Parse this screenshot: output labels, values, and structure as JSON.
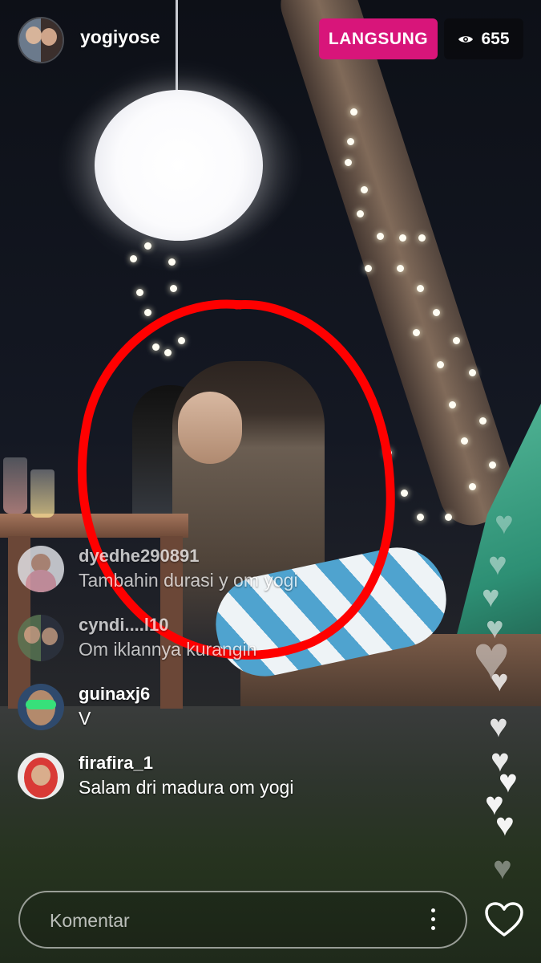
{
  "header": {
    "host_username": "yogiyose",
    "live_label": "LANGSUNG",
    "viewer_count": "655"
  },
  "comments": [
    {
      "username": "dyedhe290891",
      "text": "Tambahin durasi y om yogi",
      "faded": true
    },
    {
      "username": "cyndi....l10",
      "text": "Om iklannya kurangin",
      "faded": true
    },
    {
      "username": "guinaxj6",
      "text": "V",
      "faded": false
    },
    {
      "username": "firafira_1",
      "text": "Salam dri madura om yogi",
      "faded": false
    }
  ],
  "comment_input": {
    "placeholder": "Komentar"
  },
  "icons": {
    "eye": "eye-icon",
    "more": "more-vertical-icon",
    "like": "heart-outline-icon",
    "floating_hearts": "heart-icon"
  },
  "colors": {
    "live_badge": "#d8157a",
    "annotation_circle": "#ff0000"
  }
}
